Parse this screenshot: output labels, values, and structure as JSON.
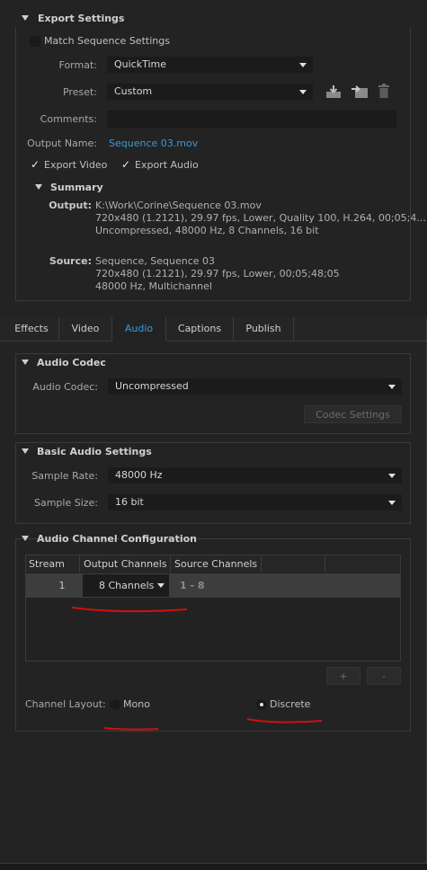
{
  "export_settings": {
    "header": "Export Settings",
    "match_sequence_label": "Match Sequence Settings",
    "match_sequence_checked": false,
    "format_label": "Format:",
    "format_value": "QuickTime",
    "preset_label": "Preset:",
    "preset_value": "Custom",
    "comments_label": "Comments:",
    "comments_value": "",
    "output_name_label": "Output Name:",
    "output_name_value": "Sequence 03.mov",
    "export_video_label": "Export Video",
    "export_video_checked": true,
    "export_audio_label": "Export Audio",
    "export_audio_checked": true,
    "icons": [
      "save-preset-icon",
      "import-preset-icon",
      "delete-preset-icon"
    ]
  },
  "summary": {
    "header": "Summary",
    "output_label": "Output:",
    "output_lines": [
      "K:\\Work\\Corine\\Sequence 03.mov",
      "720x480 (1.2121), 29.97 fps, Lower, Quality 100, H.264, 00;05;4...",
      "Uncompressed, 48000 Hz, 8 Channels, 16 bit"
    ],
    "source_label": "Source:",
    "source_lines": [
      "Sequence, Sequence 03",
      "720x480 (1.2121), 29.97 fps, Lower, 00;05;48;05",
      "48000 Hz, Multichannel"
    ]
  },
  "tabs": [
    {
      "label": "Effects"
    },
    {
      "label": "Video"
    },
    {
      "label": "Audio"
    },
    {
      "label": "Captions"
    },
    {
      "label": "Publish"
    }
  ],
  "active_tab": "Audio",
  "audio_codec": {
    "header": "Audio Codec",
    "codec_label": "Audio Codec:",
    "codec_value": "Uncompressed",
    "settings_button": "Codec Settings"
  },
  "basic_audio": {
    "header": "Basic Audio Settings",
    "sample_rate_label": "Sample Rate:",
    "sample_rate_value": "48000 Hz",
    "sample_size_label": "Sample Size:",
    "sample_size_value": "16 bit"
  },
  "channel_config": {
    "header": "Audio Channel Configuration",
    "columns": [
      "Stream",
      "Output Channels",
      "Source Channels"
    ],
    "row": {
      "stream": "1",
      "output_channels": "8 Channels",
      "source_channels": "1 - 8"
    },
    "add_button": "+",
    "remove_button": "-",
    "layout_label": "Channel Layout:",
    "mono_label": "Mono",
    "discrete_label": "Discrete",
    "selected_layout": "Discrete"
  },
  "colors": {
    "background": "#232323",
    "accent_link": "#3a9ad9",
    "annotation_red": "#d01010"
  }
}
